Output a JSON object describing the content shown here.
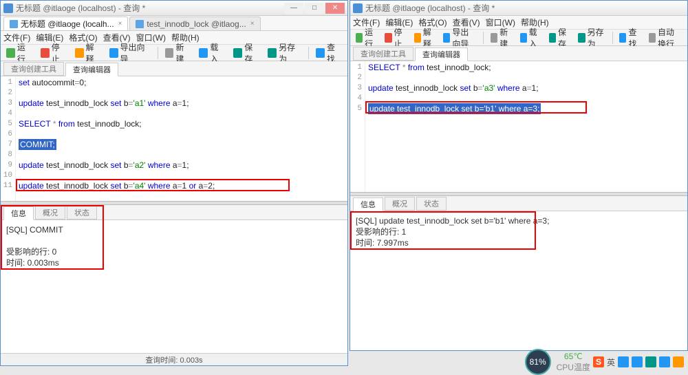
{
  "left_window": {
    "title": "无标题 @itlaoge (localhost) - 查询 *",
    "win_buttons": {
      "min": "—",
      "max": "□",
      "close": "✕"
    },
    "doctabs": [
      {
        "label": "无标题 @itlaoge (localh...",
        "active": true,
        "close": "×"
      },
      {
        "label": "test_innodb_lock @itlaog...",
        "active": false,
        "close": "×"
      }
    ],
    "menubar": [
      "文件(F)",
      "编辑(E)",
      "格式(O)",
      "查看(V)",
      "窗口(W)",
      "帮助(H)"
    ],
    "toolbar": [
      {
        "icon": "c-green",
        "label": "运行"
      },
      {
        "icon": "c-red",
        "label": "停止"
      },
      {
        "icon": "c-orange",
        "label": "解释"
      },
      {
        "icon": "c-blue",
        "label": "导出向导"
      },
      {
        "sep": true
      },
      {
        "icon": "c-gray",
        "label": "新建"
      },
      {
        "icon": "c-blue",
        "label": "载入"
      },
      {
        "icon": "c-teal",
        "label": "保存"
      },
      {
        "icon": "c-teal",
        "label": "另存为"
      },
      {
        "sep": true
      },
      {
        "icon": "c-blue",
        "label": "查找"
      }
    ],
    "editor_tabs": [
      {
        "label": "查询创建工具",
        "active": false
      },
      {
        "label": "查询编辑器",
        "active": true
      }
    ],
    "code_lines": [
      {
        "n": 1,
        "html": "<span class='kw-blue'>set</span> <span class='txt'>autocommit</span><span class='kw-gray'>=</span><span class='txt'>0;</span>"
      },
      {
        "n": 2,
        "html": ""
      },
      {
        "n": 3,
        "html": "<span class='kw-blue'>update</span> <span class='txt'>test_innodb_lock</span> <span class='kw-blue'>set</span> <span class='txt'>b</span><span class='kw-gray'>=</span><span class='kw-green'>'a1'</span> <span class='kw-blue'>where</span> <span class='txt'>a</span><span class='kw-gray'>=</span><span class='txt'>1;</span>"
      },
      {
        "n": 4,
        "html": ""
      },
      {
        "n": 5,
        "html": "<span class='kw-blue'>SELECT</span> <span class='kw-gray'>*</span> <span class='kw-blue'>from</span> <span class='txt'>test_innodb_lock;</span>"
      },
      {
        "n": 6,
        "html": ""
      },
      {
        "n": 7,
        "html": "<span class='sel'>COMMIT;</span>"
      },
      {
        "n": 8,
        "html": ""
      },
      {
        "n": 9,
        "html": "<span class='kw-blue'>update</span> <span class='txt'>test_innodb_lock</span> <span class='kw-blue'>set</span> <span class='txt'>b</span><span class='kw-gray'>=</span><span class='kw-green'>'a2'</span> <span class='kw-blue'>where</span> <span class='txt'>a</span><span class='kw-gray'>=</span><span class='txt'>1;</span>"
      },
      {
        "n": 10,
        "html": ""
      },
      {
        "n": 11,
        "html": "<span class='kw-blue'>update</span> <span class='txt'>test_innodb_lock</span> <span class='kw-blue'>set</span> <span class='txt'>b</span><span class='kw-gray'>=</span><span class='kw-green'>'a4'</span> <span class='kw-blue'>where</span> <span class='txt'>a</span><span class='kw-gray'>=</span><span class='txt'>1</span> <span class='kw-blue'>or</span> <span class='txt'>a</span><span class='kw-gray'>=</span><span class='txt'>2;</span>"
      }
    ],
    "msg_tabs": [
      {
        "label": "信息",
        "active": true
      },
      {
        "label": "概况",
        "active": false
      },
      {
        "label": "状态",
        "active": false
      }
    ],
    "msg_lines": [
      "[SQL] COMMIT",
      "",
      "受影响的行: 0",
      "时间: 0.003ms"
    ],
    "statusbar": "查询时间: 0.003s"
  },
  "right_window": {
    "title": "无标题 @itlaoge (localhost) - 查询 *",
    "menubar": [
      "文件(F)",
      "编辑(E)",
      "格式(O)",
      "查看(V)",
      "窗口(W)",
      "帮助(H)"
    ],
    "toolbar": [
      {
        "icon": "c-green",
        "label": "运行"
      },
      {
        "icon": "c-red",
        "label": "停止"
      },
      {
        "icon": "c-orange",
        "label": "解释"
      },
      {
        "icon": "c-blue",
        "label": "导出向导"
      },
      {
        "sep": true
      },
      {
        "icon": "c-gray",
        "label": "新建"
      },
      {
        "icon": "c-blue",
        "label": "载入"
      },
      {
        "icon": "c-teal",
        "label": "保存"
      },
      {
        "icon": "c-teal",
        "label": "另存为"
      },
      {
        "sep": true
      },
      {
        "icon": "c-blue",
        "label": "查找"
      },
      {
        "icon": "c-gray",
        "label": "自动换行"
      }
    ],
    "editor_tabs": [
      {
        "label": "查询创建工具",
        "active": false
      },
      {
        "label": "查询编辑器",
        "active": true
      }
    ],
    "code_lines": [
      {
        "n": 1,
        "html": "<span class='kw-blue'>SELECT</span> <span class='kw-gray'>*</span> <span class='kw-blue'>from</span> <span class='txt'>test_innodb_lock;</span>"
      },
      {
        "n": 2,
        "html": ""
      },
      {
        "n": 3,
        "html": "<span class='kw-blue'>update</span> <span class='txt'>test_innodb_lock</span> <span class='kw-blue'>set</span> <span class='txt'>b</span><span class='kw-gray'>=</span><span class='kw-green'>'a3'</span> <span class='kw-blue'>where</span> <span class='txt'>a</span><span class='kw-gray'>=</span><span class='txt'>1;</span>"
      },
      {
        "n": 4,
        "html": ""
      },
      {
        "n": 5,
        "html": "<span class='sel'>update test_innodb_lock set b='b1' where a=3;</span>"
      }
    ],
    "msg_tabs": [
      {
        "label": "信息",
        "active": true
      },
      {
        "label": "概况",
        "active": false
      },
      {
        "label": "状态",
        "active": false
      }
    ],
    "msg_lines": [
      "[SQL] update test_innodb_lock set b='b1' where a=3;",
      "受影响的行: 1",
      "时间: 7.997ms"
    ]
  },
  "taskbar": {
    "gauge": "81%",
    "temp": "65℃",
    "temp_label": "CPU温度",
    "ime": "S",
    "lang": "英"
  }
}
